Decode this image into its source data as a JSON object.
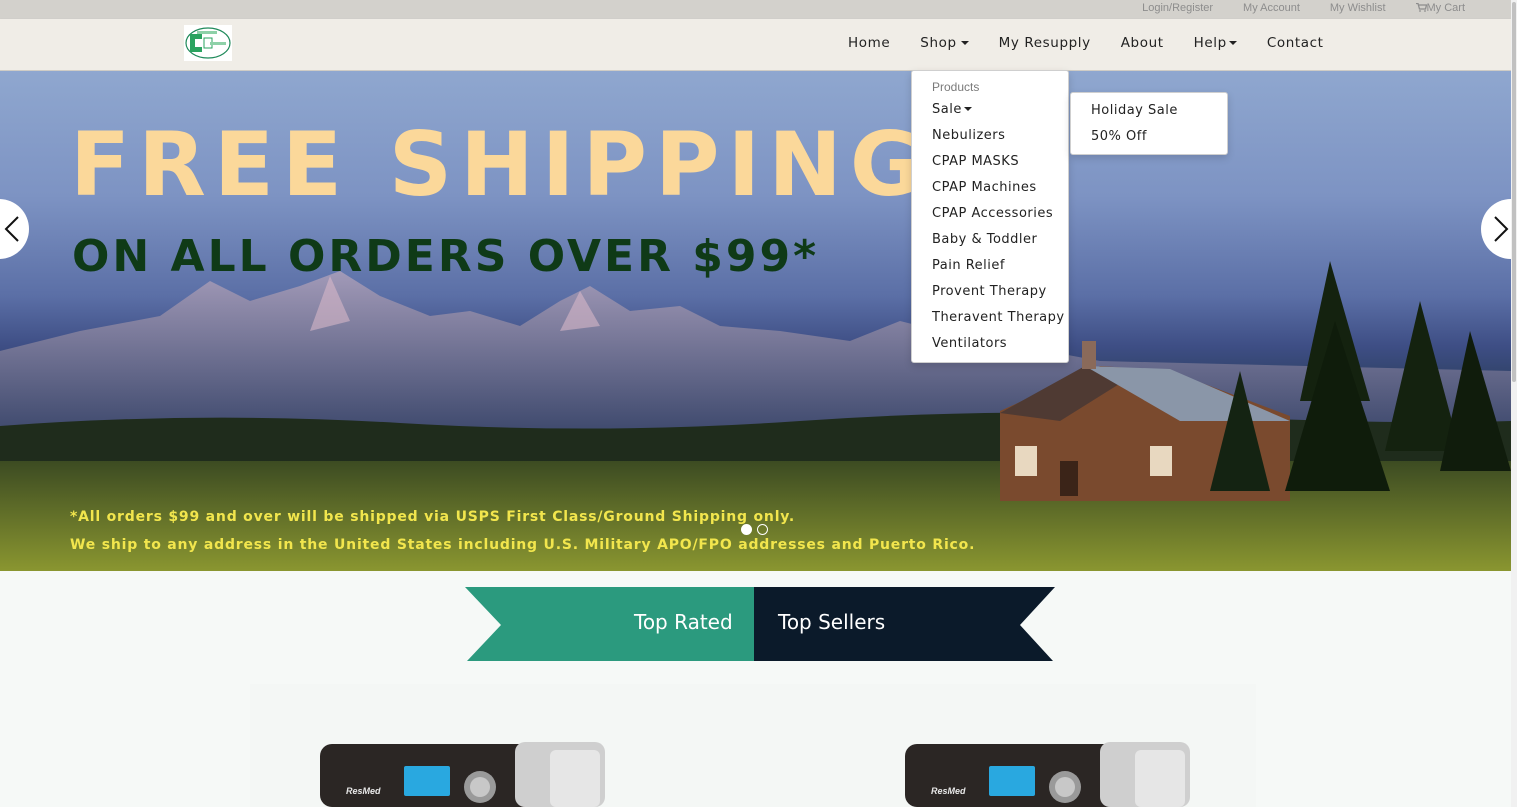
{
  "topbar": {
    "login": "Login/Register",
    "account": "My Account",
    "wishlist": "My Wishlist",
    "cart": "My Cart"
  },
  "nav": {
    "home": "Home",
    "shop": "Shop",
    "resupply": "My Resupply",
    "about": "About",
    "help": "Help",
    "contact": "Contact"
  },
  "shop_menu": {
    "header": "Products",
    "items": [
      "Sale",
      "Nebulizers",
      "CPAP MASKS",
      "CPAP Machines",
      "CPAP Accessories",
      "Baby & Toddler",
      "Pain Relief",
      "Provent Therapy",
      "Theravent Therapy",
      "Ventilators"
    ]
  },
  "sale_menu": {
    "items": [
      "Holiday Sale",
      "50% Off"
    ]
  },
  "hero": {
    "title": "FREE SHIPPING",
    "subtitle": "ON ALL ORDERS OVER $99*",
    "fine_1": "*All orders $99 and over will be shipped via USPS First Class/Ground Shipping only.",
    "fine_2": "We ship to any address in the United States including U.S. Military APO/FPO addresses and Puerto Rico."
  },
  "tabs": {
    "top_rated": "Top Rated",
    "top_sellers": "Top Sellers"
  },
  "colors": {
    "teal": "#2b9a7e",
    "navy": "#0b1a2a",
    "hero_yellow": "#f2e64d",
    "hero_title": "#fbd89a"
  }
}
